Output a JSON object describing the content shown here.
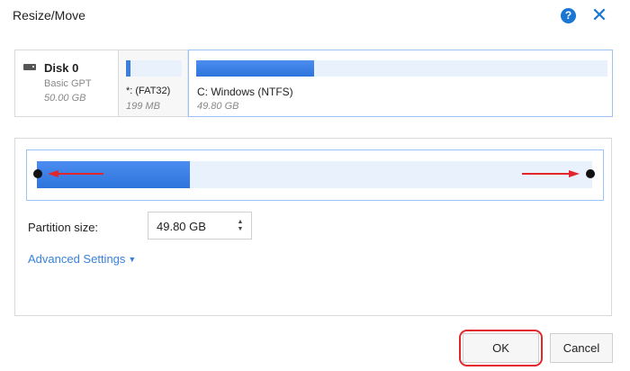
{
  "window": {
    "title": "Resize/Move",
    "help_glyph": "?",
    "close_glyph": "✕"
  },
  "disk": {
    "name": "Disk 0",
    "type": "Basic GPT",
    "size": "50.00 GB"
  },
  "partitions": [
    {
      "name": "*:  (FAT32)",
      "size": "199 MB",
      "used_fraction": 0.08
    },
    {
      "name": "C: Windows (NTFS)",
      "size": "49.80 GB",
      "used_fraction": 0.29
    }
  ],
  "slider": {
    "fill_fraction": 0.28,
    "arrow_color": "#e3262b"
  },
  "partition_size": {
    "label": "Partition size:",
    "value": "49.80 GB",
    "spin_up": "▲",
    "spin_down": "▼"
  },
  "advanced": {
    "label": "Advanced Settings",
    "chevron": "▼"
  },
  "buttons": {
    "ok_label": "OK",
    "cancel_label": "Cancel"
  },
  "colors": {
    "accent": "#1976d2",
    "bar_fill": "#3a7fe0",
    "highlight": "#e3262b"
  }
}
